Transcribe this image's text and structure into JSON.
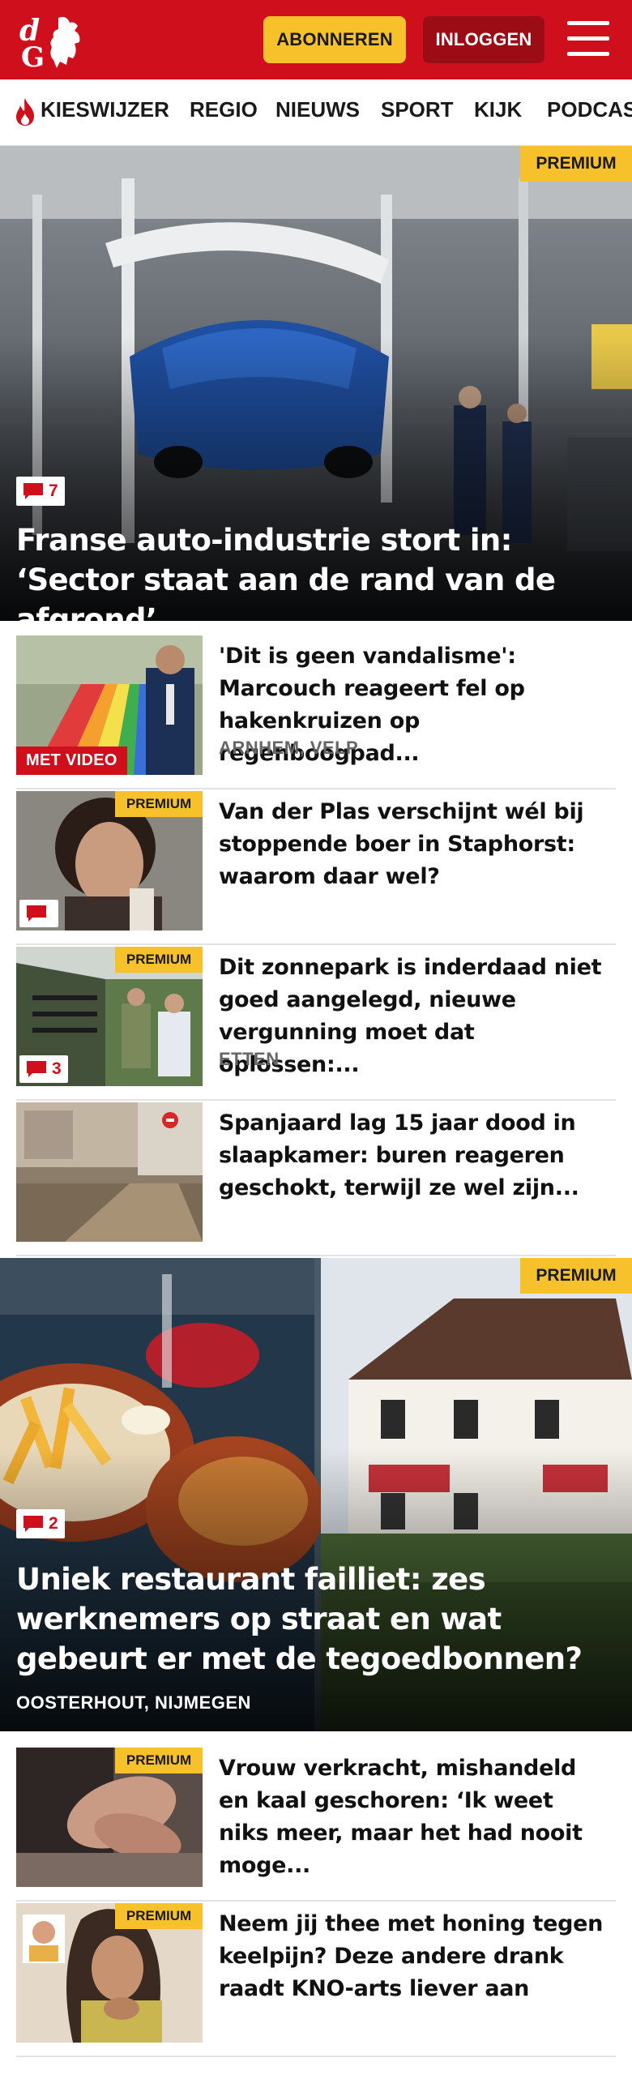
{
  "header": {
    "logo_text": "dG",
    "subscribe_label": "ABONNEREN",
    "login_label": "INLOGGEN",
    "brand_color": "#cf0f1c",
    "accent_color": "#f7c12b"
  },
  "nav": {
    "items": [
      "KIESWIJZER",
      "REGIO",
      "NIEUWS",
      "SPORT",
      "KIJK",
      "PODCAS"
    ]
  },
  "premium_label": "PREMIUM",
  "hero1": {
    "comments": "7",
    "title": "Franse auto-industrie stort in: ‘Sector staat aan de rand van de afgrond’"
  },
  "articles": [
    {
      "title": "'Dit is geen vandalisme': Marcouch reageert fel op hakenkruizen op regenboogpad...",
      "location": "ARNHEM, VELP",
      "video_label": "MET VIDEO"
    },
    {
      "title": "Van der Plas verschijnt wél bij stoppende boer in Staphorst: waarom daar wel?",
      "comments": ""
    },
    {
      "title": "Dit zonnepark is inderdaad niet goed aangelegd, nieuwe vergunning moet dat oplossen:...",
      "location": "ETTEN",
      "comments": "3"
    },
    {
      "title": "Spanjaard lag 15 jaar dood in slaapkamer: buren reageren geschokt, terwijl ze wel zijn..."
    }
  ],
  "hero2": {
    "comments": "2",
    "title": "Uniek restaurant failliet: zes werknemers op straat en wat gebeurt er met de tegoedbonnen?",
    "location": "OOSTERHOUT, NIJMEGEN"
  },
  "articles2": [
    {
      "title": "Vrouw verkracht, mishandeld en kaal geschoren: ‘Ik weet niks meer, maar het had nooit moge..."
    },
    {
      "title": "Neem jij thee met honing tegen keelpijn? Deze andere drank raadt KNO-arts liever aan"
    }
  ]
}
